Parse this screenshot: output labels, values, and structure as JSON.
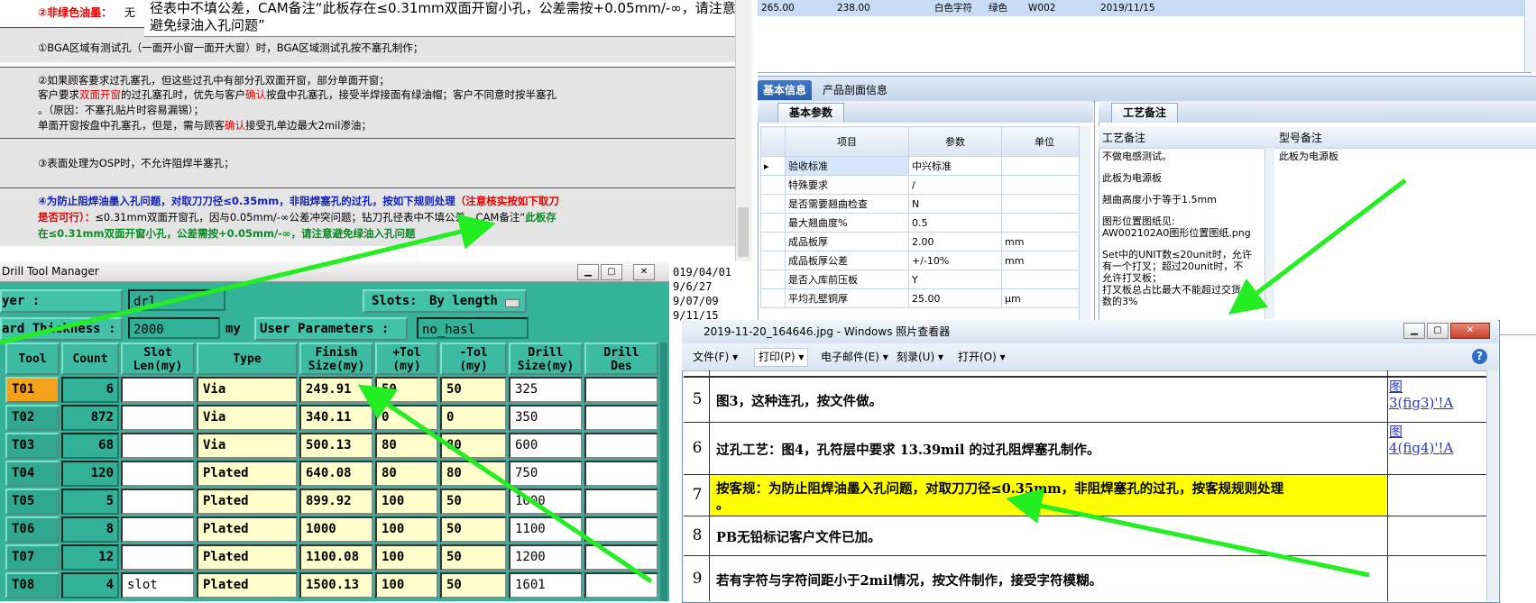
{
  "doc": {
    "row0_label": "②非绿色油墨：",
    "row0_rest": "无",
    "callout_line1": "径表中不填公差，CAM备注“此板存在≤0.31mm双面开窗小孔，公差需按+0.05mm/-∞，请注意",
    "callout_line2": "避免绿油入孔问题”",
    "p1": "①BGA区域有测试孔（一面开小窗一面开大窗）时，BGA区域测试孔按不塞孔制作；",
    "p2_line1": "②如果顾客要求过孔塞孔，但这些过孔中有部分孔双面开窗，部分单面开窗；",
    "p2_line2_a": "客户要求",
    "p2_line2_b": "双面开窗",
    "p2_line2_c": "的过孔塞孔时，优先与客户",
    "p2_line2_d": "确认",
    "p2_line2_e": "按盘中孔塞孔，接受半焊接面有绿油帽；客户不同意时按半塞孔",
    "p2_line3": "。（原因：不塞孔贴片时容易漏锡）；",
    "p2_line4_a": "单面开窗按盘中孔塞孔，但是，需与顾客",
    "p2_line4_b": "确认",
    "p2_line4_c": "接受孔单边最大2mil渗油；",
    "p3": "③表面处理为OSP时，不允许阻焊半塞孔；",
    "p4_line1_a": "④为防止阻焊油墨入孔问题，对取刀刀径≤0.35mm，非阻焊塞孔的过孔，按如下规则处理",
    "p4_line1_b": "（注意核实按如下取刀",
    "p4_line2_a": "是否可行）：",
    "p4_line2_b": "≤0.31mm双面开窗孔，因与0.05mm/-∞公差冲突问题；钻刀孔径表中不填公差，CAM备注“",
    "p4_line2_c": "此板存",
    "p4_line3": "在≤0.31mm双面开窗小孔，公差需按+0.05mm/-∞，请注意避免绿油入孔问题"
  },
  "grid_row": {
    "c1": "265.00",
    "c2": "238.00",
    "c3": "白色字符",
    "c4": "绿色",
    "c5": "W002",
    "c6": "2019/11/15"
  },
  "tabs": {
    "basic": "基本信息",
    "profile": "产品剖面信息",
    "basic_params": "基本参数",
    "craft_notes": "工艺备注"
  },
  "param_table": {
    "headers": [
      "项目",
      "参数",
      "单位"
    ],
    "rows": [
      {
        "name": "验收标准",
        "value": "中兴标准",
        "unit": ""
      },
      {
        "name": "特殊要求",
        "value": "/",
        "unit": ""
      },
      {
        "name": "是否需要翘曲检查",
        "value": "N",
        "unit": ""
      },
      {
        "name": "最大翘曲度%",
        "value": "0.5",
        "unit": ""
      },
      {
        "name": "成品板厚",
        "value": "2.00",
        "unit": "mm"
      },
      {
        "name": "成品板厚公差",
        "value": "+/-10%",
        "unit": "mm"
      },
      {
        "name": "是否入库前压板",
        "value": "Y",
        "unit": ""
      },
      {
        "name": "平均孔壁铜厚",
        "value": "25.00",
        "unit": "μm"
      }
    ]
  },
  "craft": {
    "col1": "工艺备注",
    "col2": "型号备注",
    "notes": [
      "不做电感测试。",
      "此板为电源板",
      "翘曲高度小于等于1.5mm",
      "图形位置图纸见:",
      "AW002102A0图形位置图纸.png",
      "Set中的UNIT数≤20unit时，允许",
      "有一个打叉；超过20unit时，不",
      "允许打叉板；",
      "打叉板总占比最大不能超过交货",
      "数的3%"
    ],
    "model_note": "此板为电源板"
  },
  "side_dates": [
    "019/04/01",
    "9/6/27",
    "9/07/09",
    "9/11/15"
  ],
  "dtm": {
    "title": "Drill Tool Manager",
    "layer_label": "yer       :",
    "layer_value": "drl",
    "slots_label": "Slots:",
    "slots_value": "By length",
    "thick_label": "ard Thickness :",
    "thick_value": "2000",
    "thick_unit": "my",
    "userparam_label": "User Parameters :",
    "userparam_value": "no_hasl",
    "headers": {
      "tool": "Tool",
      "count": "Count",
      "slot1": "Slot",
      "slot2": "Len(my)",
      "type": "Type",
      "finish1": "Finish",
      "finish2": "Size(my)",
      "ptol1": "+Tol",
      "ptol2": "(my)",
      "mtol1": "-Tol",
      "mtol2": "(my)",
      "drill1": "Drill",
      "drill2": "Size(my)",
      "des1": "Drill",
      "des2": "Des"
    },
    "rows": [
      {
        "tool": "T01",
        "count": "6",
        "slot": "",
        "type": "Via",
        "finish": "249.91",
        "ptol": "50",
        "mtol": "50",
        "drill": "325"
      },
      {
        "tool": "T02",
        "count": "872",
        "slot": "",
        "type": "Via",
        "finish": "340.11",
        "ptol": "0",
        "mtol": "0",
        "drill": "350"
      },
      {
        "tool": "T03",
        "count": "68",
        "slot": "",
        "type": "Via",
        "finish": "500.13",
        "ptol": "80",
        "mtol": "80",
        "drill": "600"
      },
      {
        "tool": "T04",
        "count": "120",
        "slot": "",
        "type": "Plated",
        "finish": "640.08",
        "ptol": "80",
        "mtol": "80",
        "drill": "750"
      },
      {
        "tool": "T05",
        "count": "5",
        "slot": "",
        "type": "Plated",
        "finish": "899.92",
        "ptol": "100",
        "mtol": "50",
        "drill": "1000"
      },
      {
        "tool": "T06",
        "count": "8",
        "slot": "",
        "type": "Plated",
        "finish": "1000",
        "ptol": "100",
        "mtol": "50",
        "drill": "1100"
      },
      {
        "tool": "T07",
        "count": "12",
        "slot": "",
        "type": "Plated",
        "finish": "1100.08",
        "ptol": "100",
        "mtol": "50",
        "drill": "1200"
      },
      {
        "tool": "T08",
        "count": "4",
        "slot": "slot",
        "type": "Plated",
        "finish": "1500.13",
        "ptol": "100",
        "mtol": "50",
        "drill": "1601"
      }
    ]
  },
  "viewer": {
    "title": "2019-11-20_164646.jpg - Windows 照片查看器",
    "menu": [
      "文件(F)",
      "打印(P)",
      "电子邮件(E)",
      "刻录(U)",
      "打开(O)"
    ],
    "rows": [
      {
        "num": "5",
        "text": "图3，这种连孔，按文件做。",
        "link1": "图",
        "link2": "3(fig3)'!A"
      },
      {
        "num": "6",
        "text": "过孔工艺：图4，孔符层中要求 13.39mil 的过孔阻焊塞孔制作。",
        "link1": "图",
        "link2": "4(fig4)'!A"
      },
      {
        "num": "7",
        "text": "按客规：为防止阻焊油墨入孔问题，对取刀刀径≤0.35mm，非阻焊塞孔的过孔，按客规规则处理",
        "text2": "。",
        "link1": "",
        "link2": ""
      },
      {
        "num": "8",
        "text": "PB无铅标记客户文件已加。",
        "link1": "",
        "link2": ""
      },
      {
        "num": "9",
        "text": "若有字符与字符间距小于2mil情况，按文件制作，接受字符模糊。",
        "link1": "",
        "link2": ""
      }
    ]
  },
  "colors": {
    "drill_bg": "#35b39a",
    "highlight_yellow": "#ffff00",
    "arrow_green": "#22ee22",
    "tool_active": "#f4a21b"
  }
}
